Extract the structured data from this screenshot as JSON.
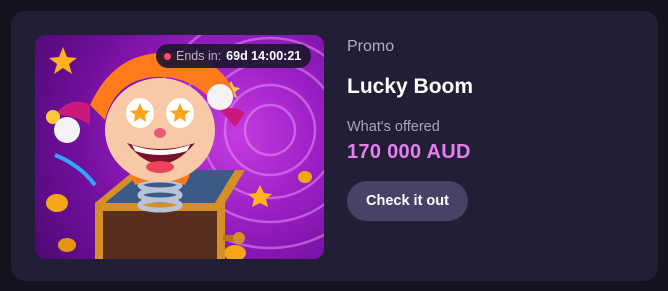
{
  "promo": {
    "timer": {
      "label": "Ends in:",
      "value": "69d 14:00:21"
    },
    "image": {
      "depicts": "jester-in-the-box"
    },
    "category": "Promo",
    "title": "Lucky Boom",
    "offer_label": "What's offered",
    "offer_value": "170 000 AUD",
    "cta_label": "Check it out"
  },
  "colors": {
    "page_bg": "#14121f",
    "card_bg": "#221e35",
    "accent": "#e57ff0",
    "button_bg": "#4a4166",
    "timer_dot": "#ff4d6a"
  }
}
